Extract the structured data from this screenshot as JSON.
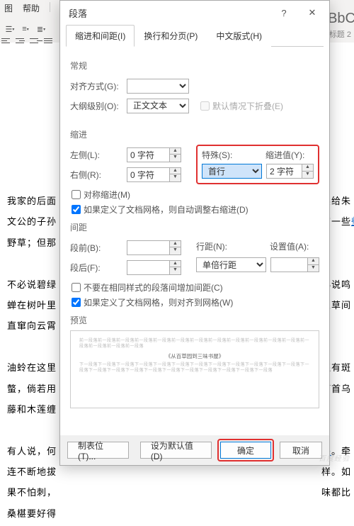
{
  "bg": {
    "menu": [
      "图",
      "帮助"
    ],
    "style_label": "AaBbC",
    "style_name": "标题 2",
    "doc_paras_left": [
      "我家的后面",
      "文公的子孙",
      "野草；但那",
      "",
      "不必说碧绿",
      "蝉在树叶里",
      "直窜向云霄",
      "",
      "油蛉在这里",
      "螫，倘若用",
      "藤和木莲缠",
      "",
      "有人说，何",
      "连不断地拔",
      "果不怕刺，",
      "桑椹要好得"
    ],
    "doc_paras_right": [
      "卖给朱",
      "有一些",
      "",
      "",
      "必说鸣",
      "从草间",
      "",
      "",
      "还有斑",
      "何首乌",
      "",
      "",
      "来。牵",
      "样。如",
      "味都比"
    ]
  },
  "dlg": {
    "title": "段落",
    "help": "?",
    "close": "✕",
    "tabs": [
      "缩进和间距(I)",
      "换行和分页(P)",
      "中文版式(H)"
    ],
    "sec_general": "常规",
    "align_label": "对齐方式(G):",
    "align_value": "",
    "outline_label": "大纲级别(O):",
    "outline_value": "正文文本",
    "collapse": "默认情况下折叠(E)",
    "sec_indent": "缩进",
    "left_label": "左侧(L):",
    "left_value": "0 字符",
    "right_label": "右侧(R):",
    "right_value": "0 字符",
    "special_label": "特殊(S):",
    "special_value": "首行",
    "indent_val_label": "缩进值(Y):",
    "indent_val_value": "2 字符",
    "mirror": "对称缩进(M)",
    "grid_adjust": "如果定义了文档网格，则自动调整右缩进(D)",
    "sec_spacing": "间距",
    "before_label": "段前(B):",
    "before_value": "",
    "after_label": "段后(F):",
    "after_value": "",
    "line_label": "行距(N):",
    "line_value": "单倍行距",
    "setval_label": "设置值(A):",
    "setval_value": "",
    "no_space": "不要在相同样式的段落间增加间距(C)",
    "grid_align": "如果定义了文档网格，则对齐到网格(W)",
    "sec_preview": "预览",
    "preview_mid": "《从百草园到三味书屋》",
    "btn_tabs": "制表位(T)...",
    "btn_default": "设为默认值(D)",
    "btn_ok": "确定",
    "btn_cancel": "取消"
  },
  "watermark": "百度经验"
}
